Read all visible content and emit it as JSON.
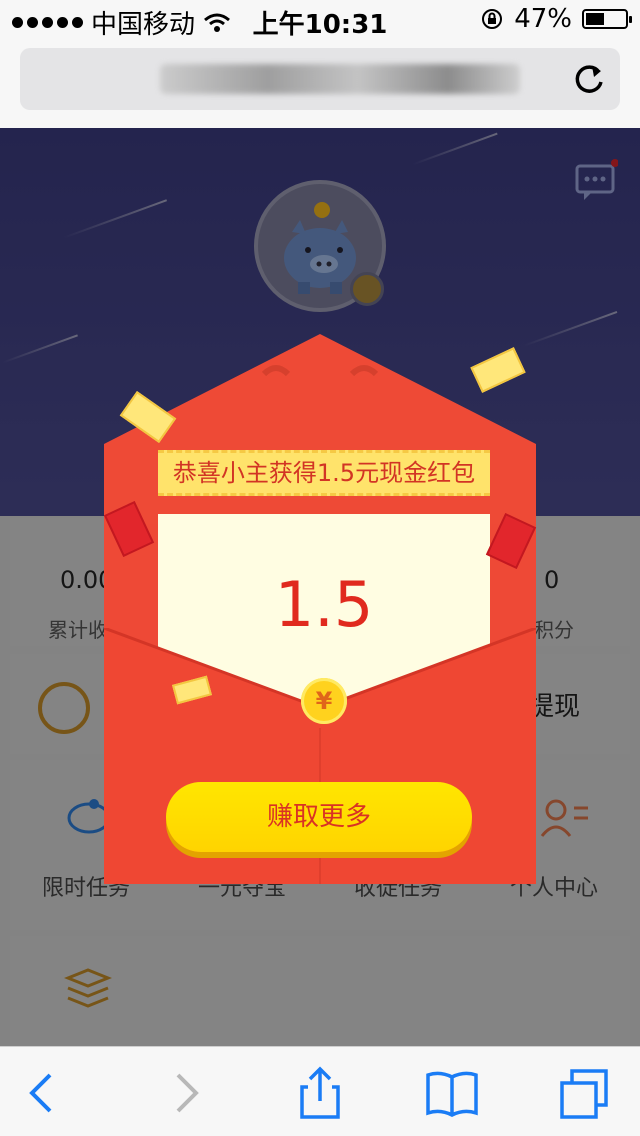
{
  "status_bar": {
    "carrier": "中国移动",
    "time": "上午10:31",
    "battery_percent": "47%",
    "battery_level": 0.47
  },
  "browser": {
    "url": "",
    "reload_icon": "reload-icon"
  },
  "stats": {
    "left_value": "0.00",
    "left_label": "累计收",
    "right_value": "0",
    "right_label": "积分"
  },
  "actions": {
    "withdraw_partial": "提现"
  },
  "grid": {
    "items": [
      "限时任务",
      "一元夺宝",
      "收徒任务",
      "个人中心"
    ]
  },
  "modal": {
    "banner_text": "恭喜小主获得1.5元现金红包",
    "amount": "1.5",
    "coin_symbol": "¥",
    "earn_more_label": "赚取更多"
  },
  "colors": {
    "hero": "#3f3f82",
    "envelope_red": "#ee4936",
    "gold": "#ffd400",
    "accent_text": "#d93224"
  }
}
